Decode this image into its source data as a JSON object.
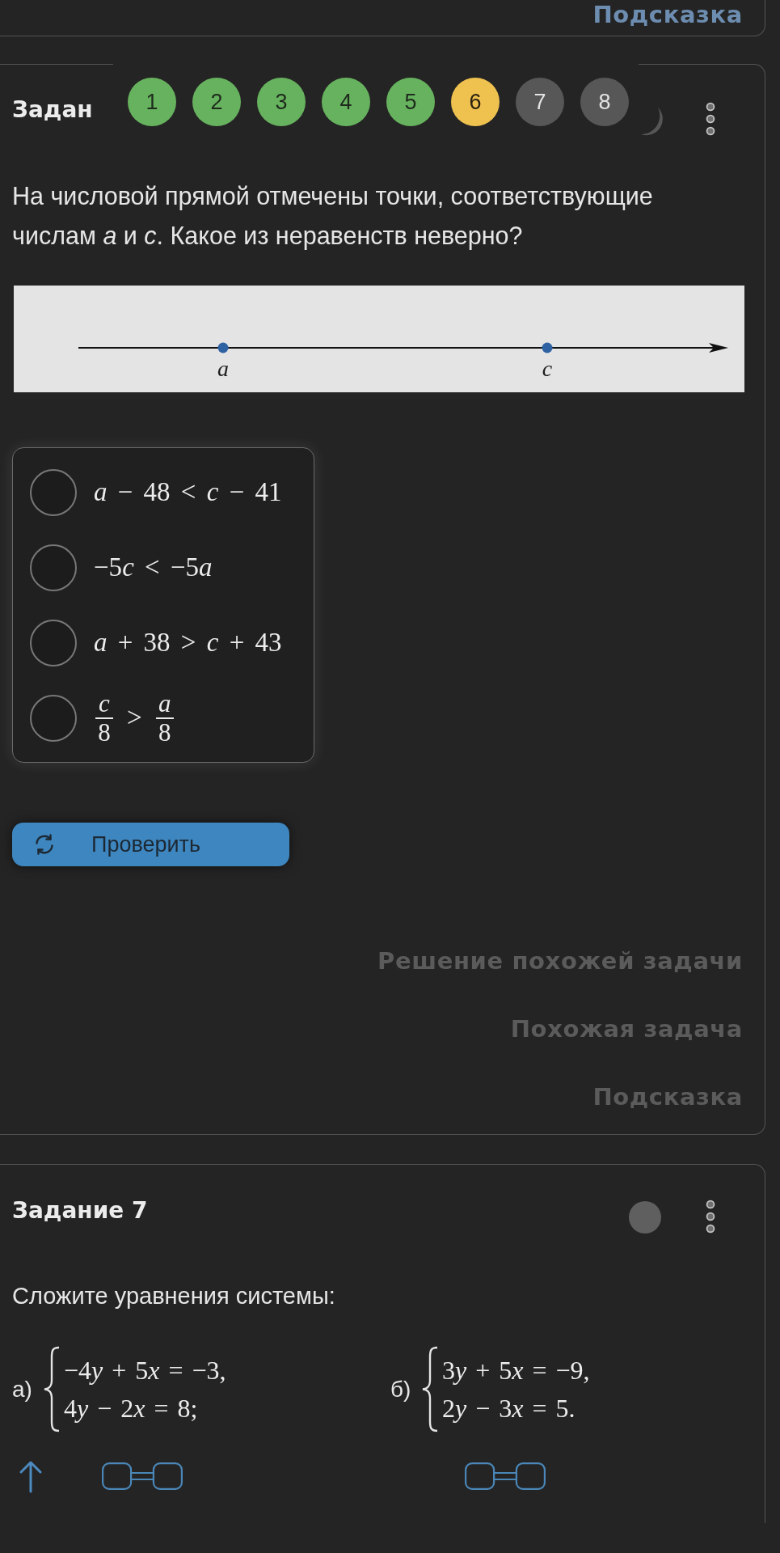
{
  "previous_task": {
    "links": [
      {
        "label": "Подсказка",
        "active": true
      }
    ]
  },
  "task_6": {
    "title": "Задан",
    "steps": [
      {
        "label": "1",
        "solved": true,
        "selected": false
      },
      {
        "label": "2",
        "solved": true,
        "selected": false
      },
      {
        "label": "3",
        "solved": true,
        "selected": false
      },
      {
        "label": "4",
        "solved": true,
        "selected": false
      },
      {
        "label": "5",
        "solved": true,
        "selected": false
      },
      {
        "label": "6",
        "solved": false,
        "selected": true
      },
      {
        "label": "7",
        "solved": false,
        "selected": false
      },
      {
        "label": "8",
        "solved": false,
        "selected": false
      }
    ],
    "question": "На числовой прямой отмечены точки, соответствующие числам *a* и *c*. Какое из неравенств неверно?",
    "number_line": {
      "points": [
        {
          "label": "a"
        },
        {
          "label": "c"
        }
      ]
    },
    "options": [
      {
        "kind": "inline",
        "math": "a − 48 < c − 41",
        "selected": false
      },
      {
        "kind": "inline",
        "math": "−5c < −5a",
        "selected": false
      },
      {
        "kind": "inline",
        "math": "a + 38 > c + 43",
        "selected": false
      },
      {
        "kind": "fraction",
        "left": {
          "numerator": "c",
          "denominator": "8"
        },
        "relation": ">",
        "right": {
          "numerator": "a",
          "denominator": "8"
        },
        "selected": false
      }
    ],
    "check_button": {
      "label": "Проверить"
    },
    "links": [
      {
        "label": "Решение похожей задачи",
        "active": false
      },
      {
        "label": "Похожая задача",
        "active": false
      },
      {
        "label": "Подсказка",
        "active": false
      }
    ]
  },
  "task_7": {
    "title": "Задание 7",
    "prompt": "Сложите уравнения системы:",
    "systems": [
      {
        "label": "а)",
        "equations": [
          "−4y + 5x = −3,",
          "4y − 2x = 8;"
        ]
      },
      {
        "label": "б)",
        "equations": [
          "3y + 5x = −9,",
          "2y − 3x = 5."
        ]
      }
    ]
  }
}
